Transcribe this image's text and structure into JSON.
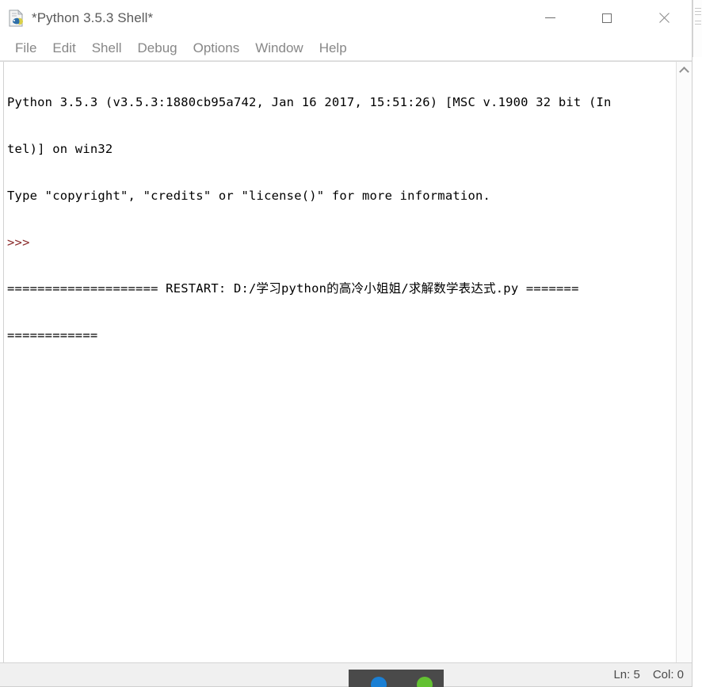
{
  "window": {
    "title": "*Python 3.5.3 Shell*",
    "app_icon": "idle-document-icon",
    "controls": {
      "minimize": "minimize-icon",
      "maximize": "maximize-icon",
      "close": "close-icon"
    }
  },
  "menubar": {
    "items": [
      {
        "label": "File"
      },
      {
        "label": "Edit"
      },
      {
        "label": "Shell"
      },
      {
        "label": "Debug"
      },
      {
        "label": "Options"
      },
      {
        "label": "Window"
      },
      {
        "label": "Help"
      }
    ]
  },
  "shell": {
    "lines": [
      "Python 3.5.3 (v3.5.3:1880cb95a742, Jan 16 2017, 15:51:26) [MSC v.1900 32 bit (In",
      "tel)] on win32",
      "Type \"copyright\", \"credits\" or \"license()\" for more information."
    ],
    "prompt": ">>>",
    "restart_line": "==================== RESTART: D:/学习python的高冷小姐姐/求解数学表达式.py =======",
    "restart_wrap": "============",
    "prompt_color": "#8a2b2b",
    "text_color": "#000000",
    "background": "#ffffff"
  },
  "scrollbar": {
    "up_arrow": "chevron-up-icon"
  },
  "statusbar": {
    "line_label": "Ln: 5",
    "col_label": "Col: 0"
  },
  "taskbar": {
    "icons": [
      {
        "name": "taskbar-icon-blue",
        "color": "#1a7fd4"
      },
      {
        "name": "taskbar-icon-green",
        "color": "#63c132"
      }
    ]
  }
}
